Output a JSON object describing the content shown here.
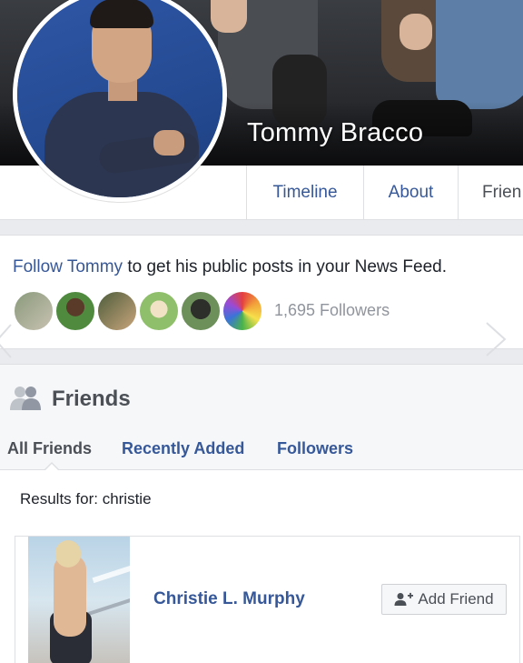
{
  "cover": {
    "name": "Tommy Bracco"
  },
  "tabs": [
    {
      "label": "Timeline"
    },
    {
      "label": "About"
    },
    {
      "label": "Frien"
    }
  ],
  "follow": {
    "prefix": "Follow Tommy",
    "suffix": " to get his public posts in your News Feed.",
    "followers_count": "1,695 Followers"
  },
  "friends": {
    "title": "Friends",
    "tabs": [
      {
        "label": "All Friends"
      },
      {
        "label": "Recently Added"
      },
      {
        "label": "Followers"
      }
    ],
    "results": "Results for: christie",
    "items": [
      {
        "name": "Christie L. Murphy",
        "add_label": "Add Friend"
      }
    ]
  },
  "colors": {
    "link": "#365899",
    "text": "#1d2129",
    "muted": "#90949c",
    "border": "#dddfe2"
  },
  "icons": {
    "friends_section": "friends-icon",
    "add_friend": "add-friend-icon",
    "carousel_prev": "chevron-left-icon",
    "carousel_next": "chevron-right-icon"
  }
}
